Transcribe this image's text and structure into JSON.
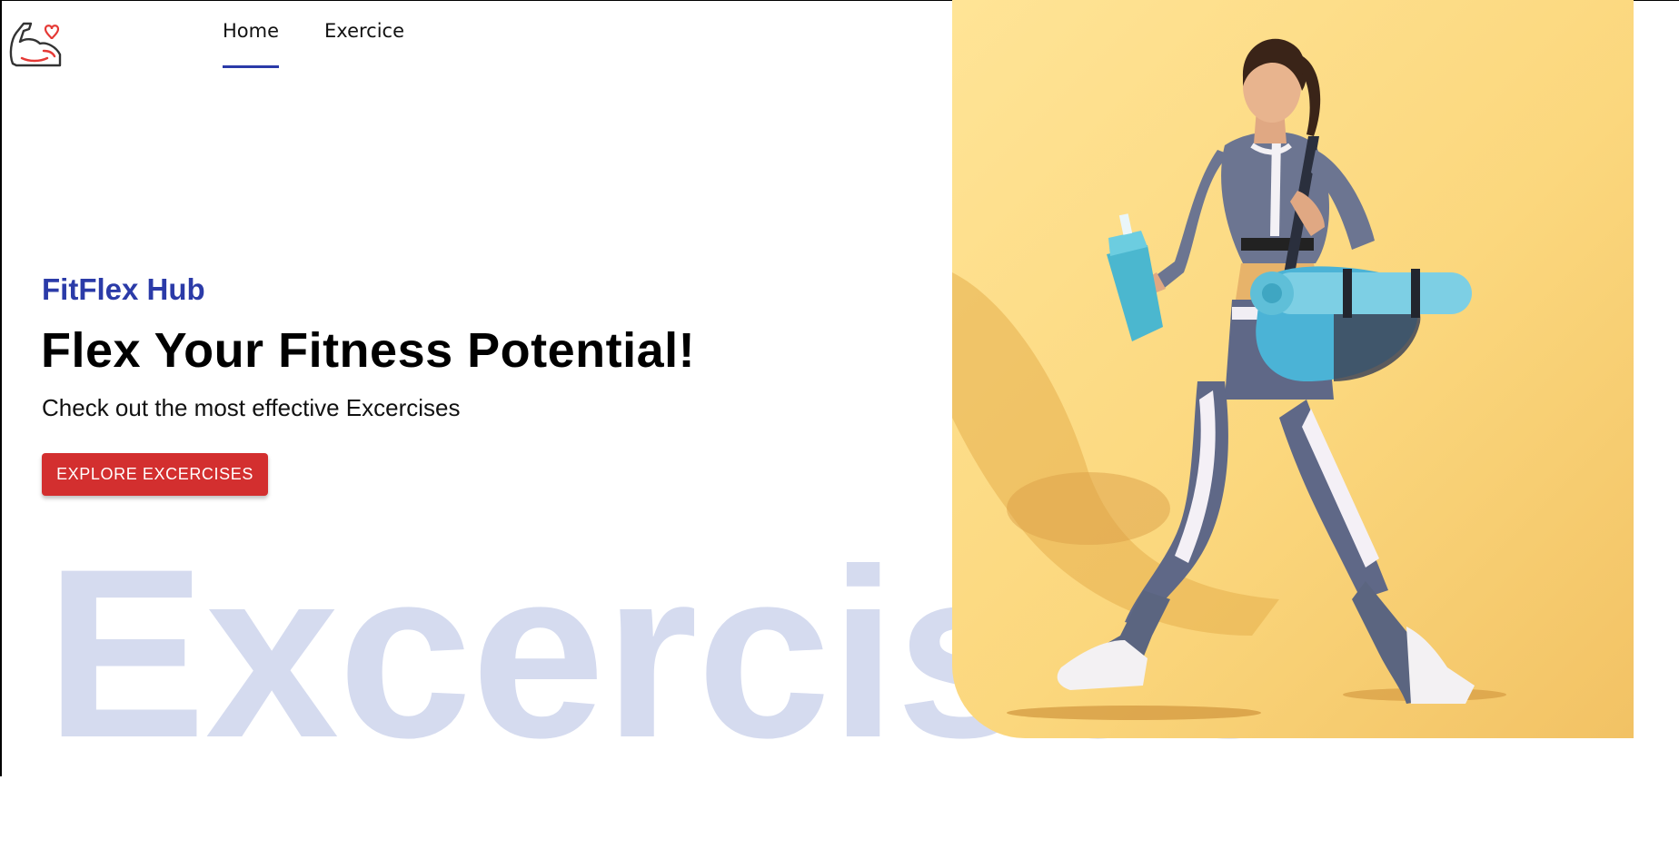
{
  "header": {
    "logo_icon": "flexed-arm-heart-icon",
    "nav": [
      {
        "label": "Home",
        "active": true
      },
      {
        "label": "Exercice",
        "active": false
      }
    ]
  },
  "hero": {
    "brand": "FitFlex Hub",
    "headline": "Flex Your Fitness Potential!",
    "subline": "Check out the most effective Excercises",
    "cta_label": "EXPLORE EXCERCISES",
    "watermark": "Excercises"
  },
  "colors": {
    "brand": "#2b3ba8",
    "cta": "#d32f2f",
    "watermark": "#d5dbef",
    "hero_background": "#fbd77d"
  }
}
